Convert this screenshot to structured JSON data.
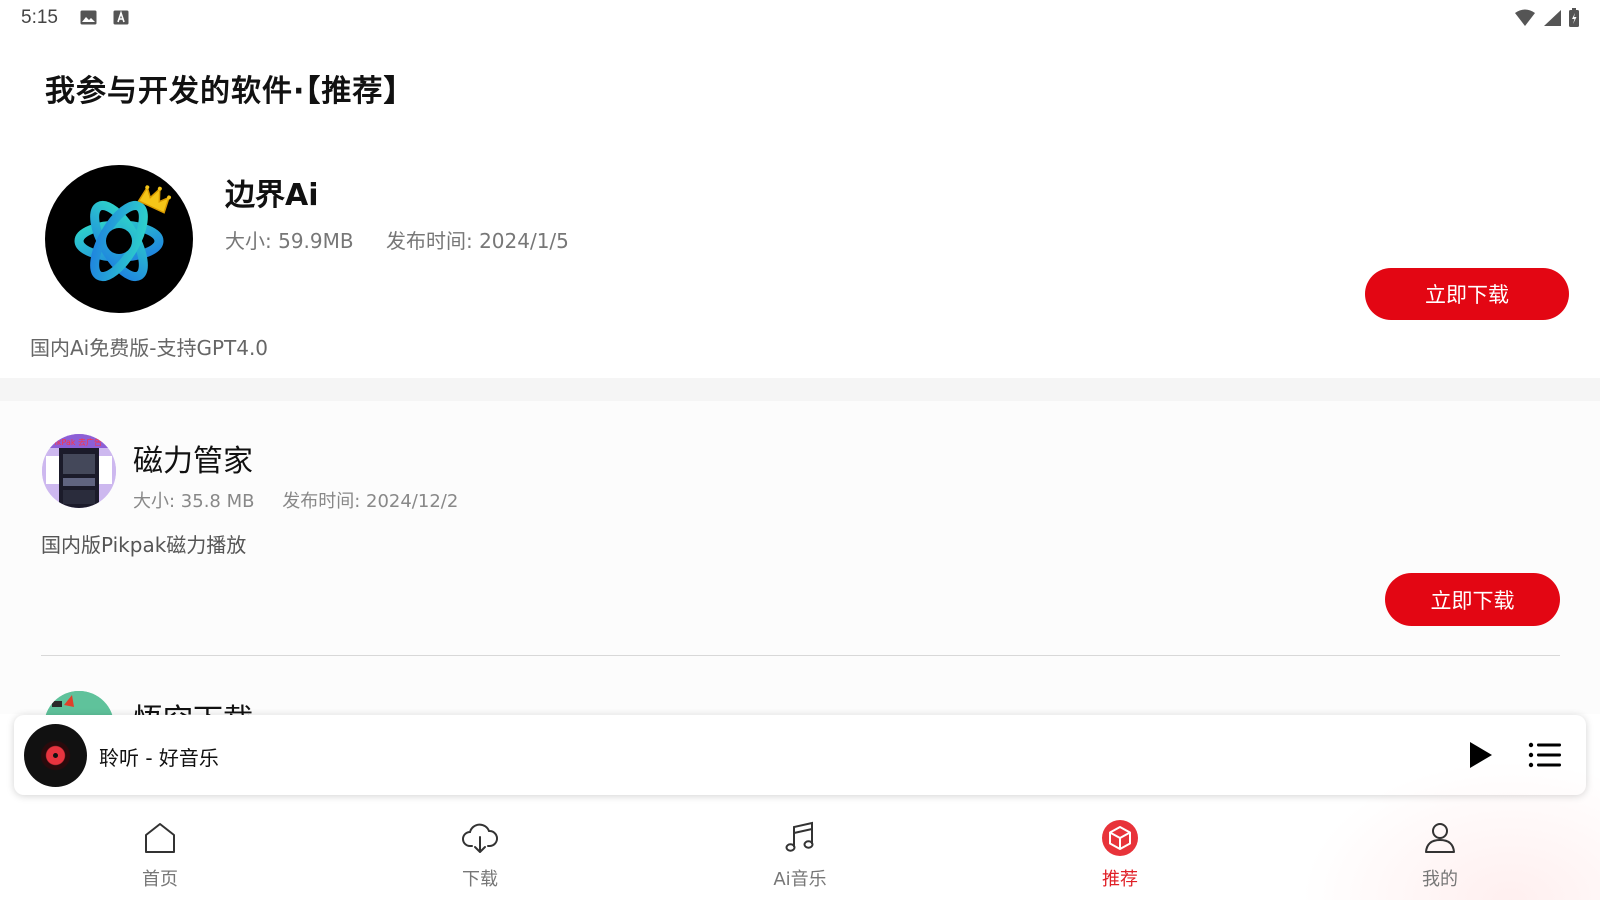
{
  "status_bar": {
    "time": "5:15",
    "icons": [
      "image-icon",
      "keyboard-a-icon",
      "wifi-icon",
      "signal-icon",
      "battery-charging-icon"
    ]
  },
  "page": {
    "title": "我参与开发的软件·【推荐】"
  },
  "apps": [
    {
      "name": "边界Ai",
      "size": "大小: 59.9MB",
      "date": "发布时间: 2024/1/5",
      "description": "国内Ai免费版-支持GPT4.0",
      "button_label": "立即下载",
      "icon": "openai-knot-icon"
    },
    {
      "name": "磁力管家",
      "size": "大小: 35.8 MB",
      "date": "发布时间: 2024/12/2",
      "description": "国内版Pikpak磁力播放",
      "button_label": "立即下载",
      "icon": "app-screenshot-icon"
    },
    {
      "name": "悟空下载",
      "icon": "wukong-icon"
    }
  ],
  "player": {
    "title": "聆听 - 好音乐",
    "play_icon": "play-icon",
    "playlist_icon": "playlist-icon"
  },
  "bottom_nav": {
    "items": [
      {
        "label": "首页",
        "icon": "home-icon",
        "active": false
      },
      {
        "label": "下载",
        "icon": "cloud-download-icon",
        "active": false
      },
      {
        "label": "Ai音乐",
        "icon": "music-note-icon",
        "active": false
      },
      {
        "label": "推荐",
        "icon": "cube-icon",
        "active": true
      },
      {
        "label": "我的",
        "icon": "person-icon",
        "active": false
      }
    ]
  },
  "colors": {
    "accent": "#e30613",
    "nav_active": "#e01f26",
    "text_secondary": "#777777"
  }
}
